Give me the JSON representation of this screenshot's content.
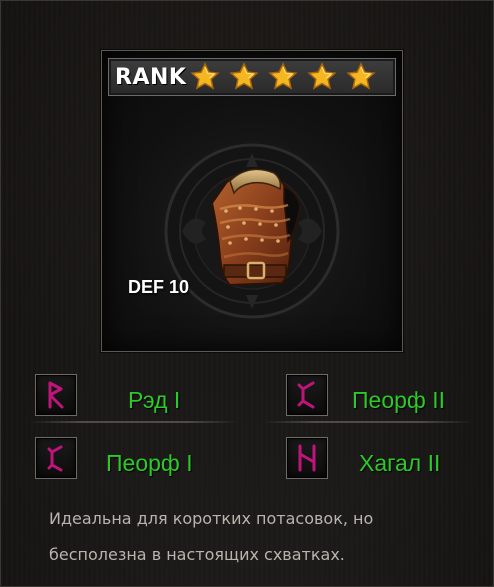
{
  "rank": {
    "label": "RANK",
    "stars_filled": 5,
    "stars_total": 5,
    "star_color": "#f2b21e"
  },
  "item": {
    "icon": "leather-armor-icon",
    "stat_text": "DEF 10"
  },
  "runes": [
    {
      "icon": "rune-r-icon",
      "name": "Рэд I"
    },
    {
      "icon": "rune-peorth-icon",
      "name": "Пеорф II"
    },
    {
      "icon": "rune-peorth-icon",
      "name": "Пеорф I"
    },
    {
      "icon": "rune-hagal-icon",
      "name": "Хагал II"
    }
  ],
  "rune_color": "#2cc928",
  "rune_glyph_color": "#c0147a",
  "description": {
    "line1": "Идеальна для коротких потасовок, но",
    "line2": "бесполезна в настоящих схватках."
  }
}
